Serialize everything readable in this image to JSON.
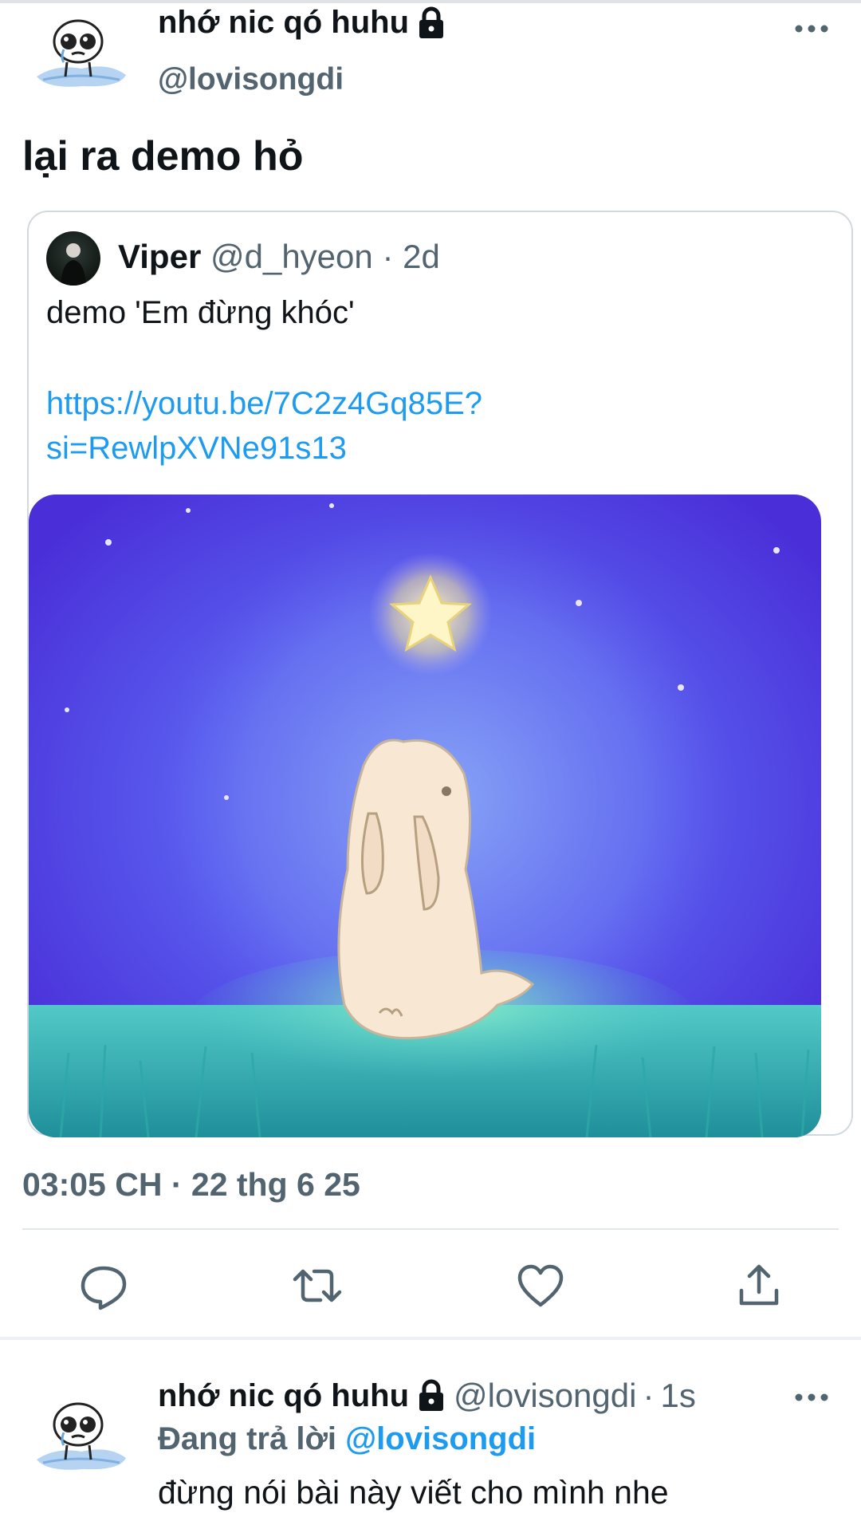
{
  "tweet": {
    "author_name": "nhớ nic qó huhu",
    "author_handle": "@lovisongdi",
    "text": "lại ra demo hỏ",
    "timestamp": "03:05 CH · 22 thg 6 25"
  },
  "quoted": {
    "author_name": "Viper",
    "author_handle": "@d_hyeon",
    "separator": "·",
    "age": "2d",
    "text": "demo 'Em đừng khóc'",
    "link_line1": "https://youtu.be/7C2z4Gq85E?",
    "link_line2": "si=RewlpXVNe91s13"
  },
  "reply": {
    "author_name": "nhớ nic qó huhu",
    "author_handle": "@lovisongdi",
    "separator": "·",
    "age": "1s",
    "replying_prefix": "Đang trả lời",
    "replying_to": "@lovisongdi",
    "text": "đừng nói bài này viết cho mình nhe"
  },
  "actions": [
    "reply-icon",
    "retweet-icon",
    "like-icon",
    "share-icon"
  ],
  "colors": {
    "link": "#1d9bf0",
    "secondary": "#536471",
    "primary": "#0f1419"
  }
}
